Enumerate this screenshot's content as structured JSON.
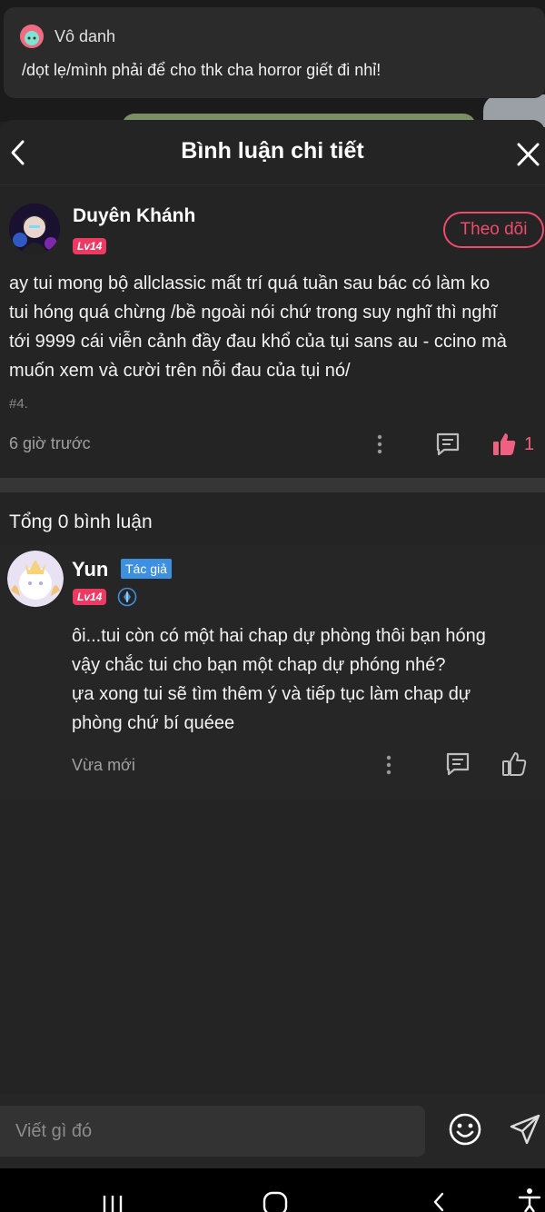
{
  "notification": {
    "sender": "Vô danh",
    "message": "/dọt lẹ/mình phải để cho thk cha horror giết đi nhỉ!"
  },
  "header": {
    "title": "Bình luận chi tiết"
  },
  "main_comment": {
    "username": "Duyên Khánh",
    "level": "Lv14",
    "follow_label": "Theo dõi",
    "body_lines": [
      "ay tui mong bộ allclassic mất trí quá tuần sau bác có làm ko",
      "tui hóng quá chừng /bề ngoài nói chứ trong suy nghĩ thì nghĩ",
      "tới 9999 cái viễn cảnh đầy đau khổ của tụi sans au - ccino mà",
      "muốn xem và cười trên nỗi đau của tụi nó/"
    ],
    "tag": "#4.",
    "time": "6 giờ trước",
    "like_count": "1"
  },
  "replies": {
    "total_label": "Tổng 0 bình luận",
    "items": [
      {
        "username": "Yun",
        "badge": "Tác giả",
        "level": "Lv14",
        "body_lines": [
          "ôi...tui còn có một hai chap dự phòng thôi bạn hóng",
          "vậy chắc tui cho bạn một chap dự phóng nhé?",
          "ựa xong tui sẽ tìm thêm ý và tiếp tục làm chap dự",
          "phòng chứ bí quéee"
        ],
        "time": "Vừa mới"
      }
    ]
  },
  "composer": {
    "placeholder": "Viết gì đó"
  },
  "colors": {
    "accent": "#ef4b6c",
    "author_badge": "#3d8fe0",
    "background": "#242424"
  },
  "icons": [
    "back-arrow-icon",
    "close-icon",
    "more-vertical-icon",
    "comment-icon",
    "thumbs-up-icon",
    "verified-icon",
    "emoji-icon",
    "send-icon"
  ]
}
